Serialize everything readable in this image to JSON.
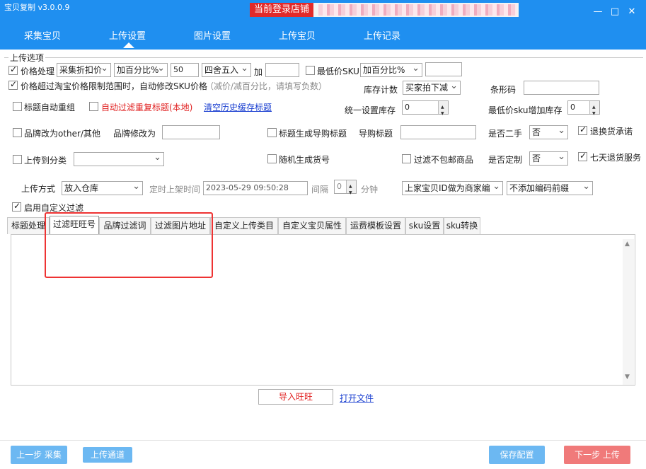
{
  "app": {
    "title": "宝贝复制 v3.0.0.9",
    "store_label": "当前登录店铺"
  },
  "window": {
    "minimize": "—",
    "maximize": "□",
    "close": "✕"
  },
  "nav": [
    "采集宝贝",
    "上传设置",
    "图片设置",
    "上传宝贝",
    "上传记录"
  ],
  "section_title": "上传选项",
  "row1": {
    "price_label": "价格处理",
    "price_select": "采集折扣价",
    "pct_select": "加百分比%",
    "pct_value": "50",
    "round_select": "四舍五入",
    "add_label": "加",
    "add_value": "",
    "min_sku_label": "最低价SKU",
    "min_sku_select": "加百分比%",
    "min_sku_value": ""
  },
  "row2": {
    "over_label": "价格超过淘宝价格限制范围时，自动修改SKU价格",
    "over_hint": "（减价/减百分比，请填写负数）",
    "stock_label": "库存计数",
    "stock_select": "买家拍下减",
    "barcode_label": "条形码",
    "barcode_value": ""
  },
  "row3": {
    "title_regroup": "标题自动重组",
    "auto_filter": "自动过滤重复标题(本地)",
    "clear_link": "清空历史缓存标题",
    "unified_stock_label": "统一设置库存",
    "unified_stock_value": "0",
    "min_sku_stock_label": "最低价sku增加库存",
    "min_sku_stock_value": "0"
  },
  "row4": {
    "brand_other": "品牌改为other/其他",
    "brand_edit_label": "品牌修改为",
    "brand_edit_value": "",
    "title_guide": "标题生成导购标题",
    "guide_title_label": "导购标题",
    "guide_title_value": "",
    "second_hand_label": "是否二手",
    "second_hand_value": "否",
    "return_promise": "退换货承诺"
  },
  "row5": {
    "upload_category": "上传到分类",
    "category_value": "",
    "random_item_no": "随机生成货号",
    "filter_no_free_ship": "过滤不包邮商品",
    "custom_label": "是否定制",
    "custom_value": "否",
    "seven_day_return": "七天退货服务"
  },
  "row6": {
    "upload_method_label": "上传方式",
    "upload_method_value": "放入仓库",
    "timed_label": "定时上架时间",
    "timed_value": "2023-05-29 09:50:28",
    "interval_label": "间隔",
    "interval_value": "0",
    "minute_label": "分钟",
    "seller_id_select": "上家宝贝ID做为商家编",
    "code_prefix_select": "不添加编码前缀"
  },
  "custom_filter": "启用自定义过滤",
  "filter_tabs": [
    "标题处理",
    "过滤旺旺号",
    "品牌过滤词",
    "过滤图片地址",
    "自定义上传类目",
    "自定义宝贝属性",
    "运费模板设置",
    "sku设置",
    "sku转换"
  ],
  "import_button": "导入旺旺",
  "open_file_link": "打开文件",
  "bottom": {
    "prev": "上一步 采集",
    "channel": "上传通道",
    "save": "保存配置",
    "next": "下一步 上传"
  },
  "colors": {
    "header": "#1f8ff0",
    "highlight": "#e33333",
    "button_blue": "#6cb8f2",
    "button_red": "#f07a7a"
  }
}
